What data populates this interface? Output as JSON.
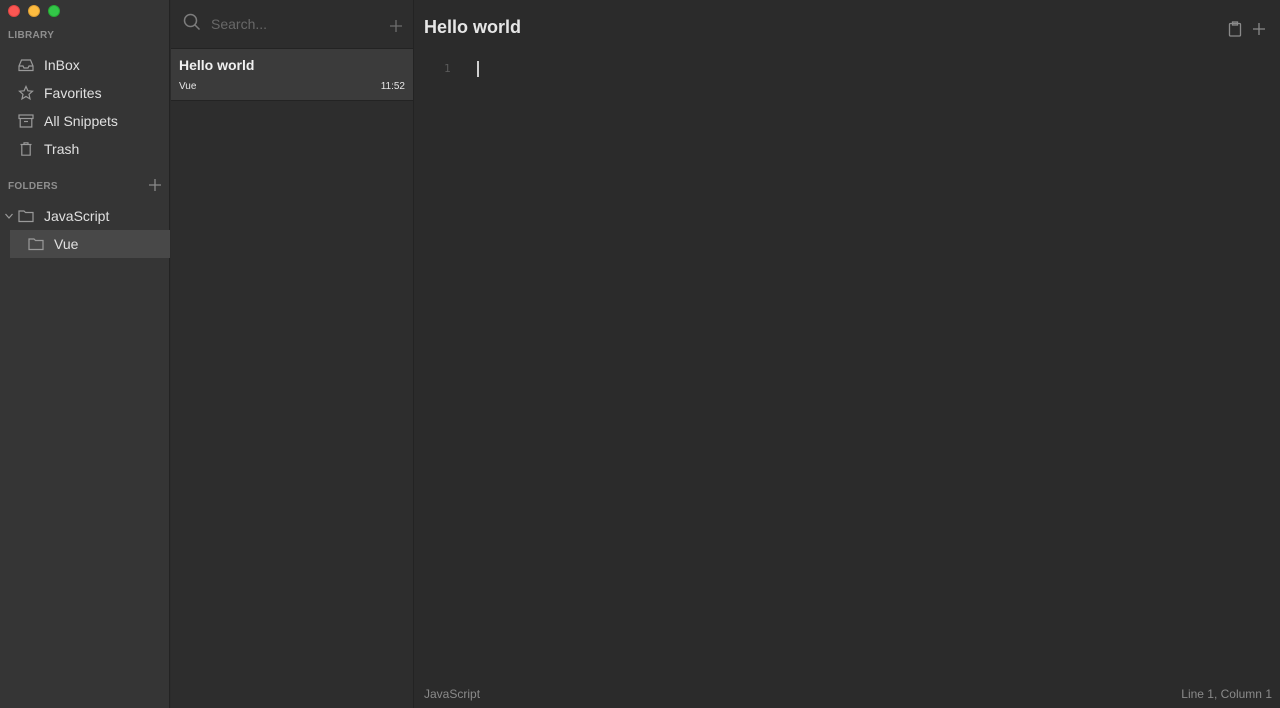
{
  "sidebar": {
    "library_title": "LIBRARY",
    "items": [
      {
        "label": "InBox",
        "icon": "inbox-icon"
      },
      {
        "label": "Favorites",
        "icon": "star-icon"
      },
      {
        "label": "All Snippets",
        "icon": "archive-icon"
      },
      {
        "label": "Trash",
        "icon": "trash-icon"
      }
    ],
    "folders_title": "FOLDERS",
    "folders": [
      {
        "label": "JavaScript",
        "expanded": true,
        "selected": false
      },
      {
        "label": "Vue",
        "expanded": false,
        "selected": true
      }
    ]
  },
  "list": {
    "search_placeholder": "Search...",
    "snippets": [
      {
        "title": "Hello world",
        "folder": "Vue",
        "time": "11:52"
      }
    ]
  },
  "editor": {
    "title": "Hello world",
    "line_number": "1",
    "language": "JavaScript",
    "position": "Line 1, Column 1"
  },
  "colors": {
    "sidebar_bg": "#353535",
    "list_bg": "#2d2d2d",
    "editor_bg": "#2b2b2b",
    "selected_bg": "#484848",
    "close": "#fc5753",
    "minimize": "#fdbc40",
    "zoom": "#33c748"
  }
}
